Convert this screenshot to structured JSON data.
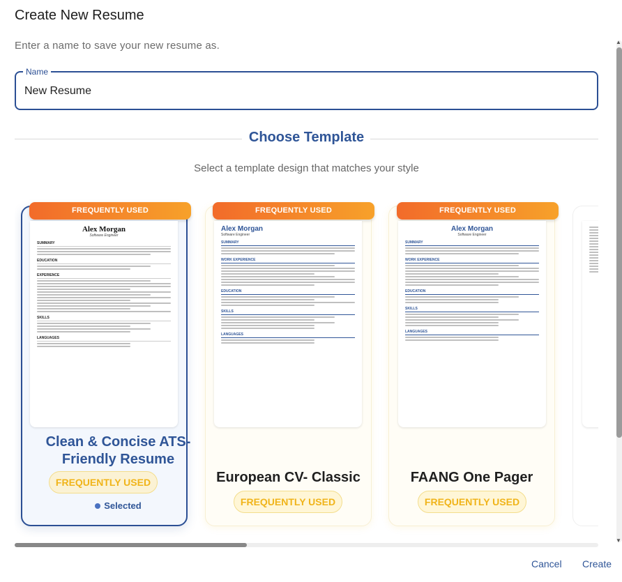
{
  "dialog": {
    "title": "Create New Resume",
    "subtitle": "Enter a name to save your new resume as."
  },
  "name_field": {
    "label": "Name",
    "value": "New Resume"
  },
  "template_section": {
    "title": "Choose Template",
    "subtitle": "Select a template design that matches your style"
  },
  "templates": [
    {
      "ribbon": "FREQUENTLY USED",
      "name": "Clean & Concise ATS-Friendly Resume",
      "badge": "FREQUENTLY USED",
      "status": "Selected",
      "preview": {
        "name": "Alex Morgan",
        "role": "Software Engineer",
        "sections": [
          "SUMMARY",
          "EDUCATION",
          "EXPERIENCE",
          "SKILLS",
          "LANGUAGES"
        ]
      }
    },
    {
      "ribbon": "FREQUENTLY USED",
      "name": "European CV- Classic",
      "badge": "FREQUENTLY USED",
      "preview": {
        "name": "Alex Morgan",
        "role": "Software Engineer",
        "sections": [
          "SUMMARY",
          "WORK EXPERIENCE",
          "EDUCATION",
          "SKILLS",
          "LANGUAGES"
        ]
      }
    },
    {
      "ribbon": "FREQUENTLY USED",
      "name": "FAANG One Pager",
      "badge": "FREQUENTLY USED",
      "preview": {
        "name": "Alex Morgan",
        "role": "Software Engineer",
        "sections": [
          "SUMMARY",
          "WORK EXPERIENCE",
          "EDUCATION",
          "SKILLS",
          "LANGUAGES"
        ]
      }
    }
  ],
  "actions": {
    "cancel": "Cancel",
    "create": "Create"
  },
  "colors": {
    "primary": "#2f5597",
    "ribbon_start": "#f26b2a",
    "ribbon_end": "#f7a12a",
    "badge_text": "#f0b41a"
  }
}
